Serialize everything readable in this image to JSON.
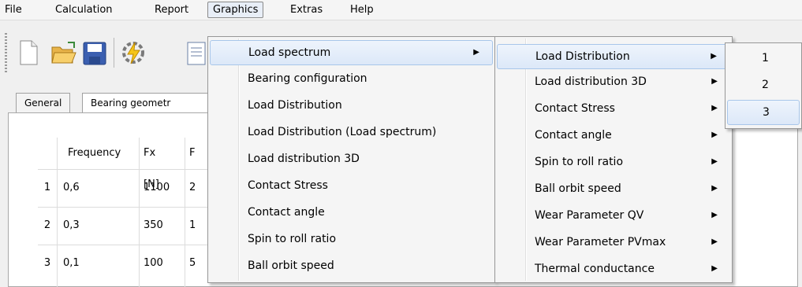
{
  "menubar": {
    "items": [
      "File",
      "Calculation",
      "Report",
      "Graphics",
      "Extras",
      "Help"
    ]
  },
  "toolbar": {
    "icons": [
      "new-document-icon",
      "open-folder-icon",
      "save-disk-icon",
      "calculate-lightning-icon",
      "report-icon"
    ]
  },
  "tabs": [
    "General",
    "Bearing geometr"
  ],
  "grid": {
    "headers": [
      "Frequency",
      "Fx [N]",
      "F"
    ],
    "rows": [
      {
        "num": "1",
        "frequency": "0,6",
        "fx": "1100",
        "f": "2"
      },
      {
        "num": "2",
        "frequency": "0,3",
        "fx": "350",
        "f": "1"
      },
      {
        "num": "3",
        "frequency": "0,1",
        "fx": "100",
        "f": "5"
      }
    ]
  },
  "graphics_menu": {
    "items": [
      "Load spectrum",
      "Bearing configuration",
      "Load Distribution",
      "Load Distribution (Load spectrum)",
      "Load distribution 3D",
      "Contact Stress",
      "Contact angle",
      "Spin to roll ratio",
      "Ball orbit speed"
    ]
  },
  "load_spectrum_menu": {
    "items": [
      "Load Distribution",
      "Load distribution 3D",
      "Contact Stress",
      "Contact angle",
      "Spin to roll ratio",
      "Ball orbit speed",
      "Wear Parameter QV",
      "Wear Parameter PVmax",
      "Thermal conductance"
    ]
  },
  "load_distribution_menu": {
    "items": [
      "1",
      "2",
      "3"
    ]
  }
}
